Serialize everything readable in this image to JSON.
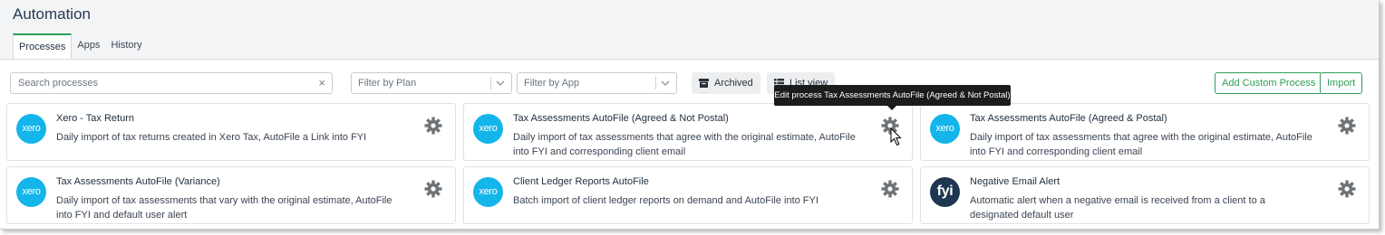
{
  "page": {
    "title": "Automation"
  },
  "tabs": [
    {
      "label": "Processes",
      "active": true
    },
    {
      "label": "Apps",
      "active": false
    },
    {
      "label": "History",
      "active": false
    }
  ],
  "toolbar": {
    "search_placeholder": "Search processes",
    "clear_icon": "×",
    "filter_plan_placeholder": "Filter by Plan",
    "filter_app_placeholder": "Filter by App",
    "archived_label": "Archived",
    "list_view_label": "List view",
    "add_custom_label": "Add Custom Process",
    "import_label": "Import"
  },
  "tooltip": {
    "text": "Edit process Tax Assessments AutoFile (Agreed & Not Postal)"
  },
  "colors": {
    "accent": "#2e9e58",
    "xero": "#13b5ea",
    "fyi": "#1e3650"
  },
  "cards": [
    {
      "logo_text": "xero",
      "title": "Xero - Tax Return",
      "description": "Daily import of tax returns created in Xero Tax, AutoFile a Link into FYI"
    },
    {
      "logo_text": "xero",
      "title": "Tax Assessments AutoFile (Agreed & Not Postal)",
      "description": "Daily import of tax assessments that agree with the original estimate, AutoFile into FYI and corresponding client email"
    },
    {
      "logo_text": "xero",
      "title": "Tax Assessments AutoFile (Agreed & Postal)",
      "description": "Daily import of tax assessments that agree with the original estimate, AutoFile into FYI and corresponding client email"
    },
    {
      "logo_text": "xero",
      "title": "Tax Assessments AutoFile (Variance)",
      "description": "Daily import of tax assessments that vary with the original estimate, AutoFile into FYI and default user alert"
    },
    {
      "logo_text": "xero",
      "title": "Client Ledger Reports AutoFile",
      "description": "Batch import of client ledger reports on demand and AutoFile into FYI"
    },
    {
      "logo_text": "fyi",
      "title": "Negative Email Alert",
      "description": "Automatic alert when a negative email is received from a client to a designated default user"
    }
  ],
  "icons": [
    "clear-icon",
    "chevron-down-icon",
    "archive-icon",
    "list-view-icon",
    "gear-icon",
    "mouse-cursor-icon"
  ]
}
